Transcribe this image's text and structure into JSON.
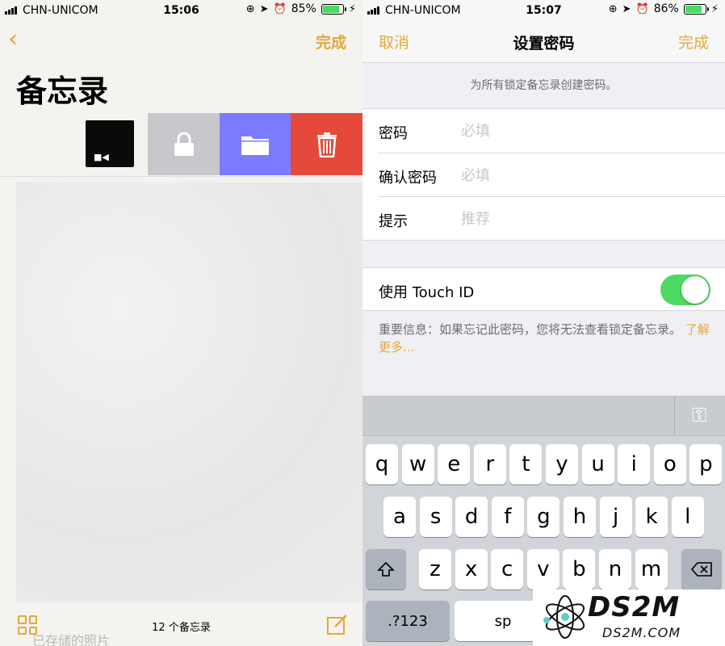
{
  "left": {
    "status": {
      "carrier": "CHN-UNICOM",
      "time": "15:06",
      "battery_percent": "85%",
      "battery_level": 0.85
    },
    "nav": {
      "done_label": "完成"
    },
    "title": "备忘录",
    "actions": [
      "lock-icon",
      "folder-icon",
      "trash-icon"
    ],
    "bottom": {
      "note_count": "12 个备忘录",
      "ghost_text": "已存储的照片"
    }
  },
  "right": {
    "status": {
      "carrier": "CHN-UNICOM",
      "time": "15:07",
      "battery_percent": "86%",
      "battery_level": 0.86
    },
    "nav": {
      "cancel_label": "取消",
      "title": "设置密码",
      "done_label": "完成"
    },
    "header_note": "为所有锁定备忘录创建密码。",
    "form": [
      {
        "label": "密码",
        "placeholder": "必填"
      },
      {
        "label": "确认密码",
        "placeholder": "必填"
      },
      {
        "label": "提示",
        "placeholder": "推荐"
      }
    ],
    "touch_id": {
      "label": "使用 Touch ID",
      "enabled": true
    },
    "footnote": {
      "text": "重要信息：如果忘记此密码，您将无法查看锁定备忘录。",
      "link": "了解更多..."
    },
    "keyboard": {
      "row1": [
        "q",
        "w",
        "e",
        "r",
        "t",
        "y",
        "u",
        "i",
        "o",
        "p"
      ],
      "row2": [
        "a",
        "s",
        "d",
        "f",
        "g",
        "h",
        "j",
        "k",
        "l"
      ],
      "row3": [
        "z",
        "x",
        "c",
        "v",
        "b",
        "n",
        "m"
      ],
      "numbers_label": ".?123",
      "space_label": "sp"
    }
  },
  "watermark": {
    "mark": "DS2M",
    "sub": "DS2M.COM"
  },
  "colors": {
    "accent": "#e3a93c",
    "toggle_on": "#4cd964",
    "delete": "#e5493c",
    "folder": "#7b7bff",
    "lock": "#c7c7cc"
  }
}
